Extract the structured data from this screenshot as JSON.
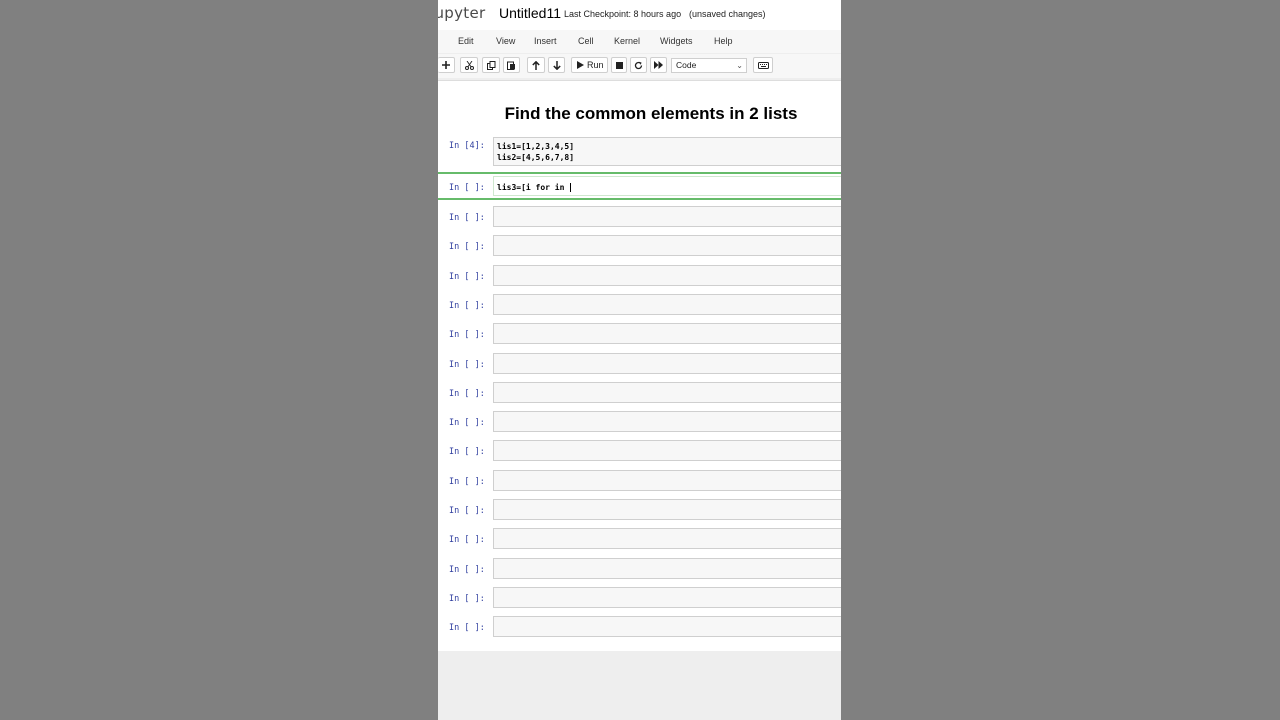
{
  "header": {
    "logo": "jupyter",
    "notebook_name": "Untitled11",
    "checkpoint": "Last Checkpoint: 8 hours ago",
    "unsaved": "(unsaved changes)"
  },
  "menu": {
    "items": [
      "Edit",
      "View",
      "Insert",
      "Cell",
      "Kernel",
      "Widgets",
      "Help"
    ]
  },
  "toolbar": {
    "run_label": "Run",
    "cell_type": "Code",
    "icons": [
      "plus-icon",
      "scissors-icon",
      "copy-icon",
      "paste-icon",
      "arrow-up-icon",
      "arrow-down-icon",
      "play-icon",
      "stop-icon",
      "restart-icon",
      "fast-forward-icon",
      "keyboard-icon"
    ]
  },
  "notebook": {
    "heading": "Find the common elements in 2 lists",
    "cells": [
      {
        "prompt": "In [4]:",
        "code_lines": [
          "lis1=[1,2,3,4,5]",
          "lis2=[4,5,6,7,8]"
        ]
      },
      {
        "prompt": "In [ ]:",
        "code_lines": [
          "lis3=[i for in "
        ],
        "active": true
      },
      {
        "prompt": "In [ ]:",
        "code_lines": []
      },
      {
        "prompt": "In [ ]:",
        "code_lines": []
      },
      {
        "prompt": "In [ ]:",
        "code_lines": []
      },
      {
        "prompt": "In [ ]:",
        "code_lines": []
      },
      {
        "prompt": "In [ ]:",
        "code_lines": []
      },
      {
        "prompt": "In [ ]:",
        "code_lines": []
      },
      {
        "prompt": "In [ ]:",
        "code_lines": []
      },
      {
        "prompt": "In [ ]:",
        "code_lines": []
      },
      {
        "prompt": "In [ ]:",
        "code_lines": []
      },
      {
        "prompt": "In [ ]:",
        "code_lines": []
      },
      {
        "prompt": "In [ ]:",
        "code_lines": []
      },
      {
        "prompt": "In [ ]:",
        "code_lines": []
      },
      {
        "prompt": "In [ ]:",
        "code_lines": []
      },
      {
        "prompt": "In [ ]:",
        "code_lines": []
      },
      {
        "prompt": "In [ ]:",
        "code_lines": []
      }
    ]
  },
  "colors": {
    "background": "#808080",
    "prompt": "#303f9f",
    "selected_border": "#66bb6a",
    "number_literal": "#2e8b57"
  }
}
